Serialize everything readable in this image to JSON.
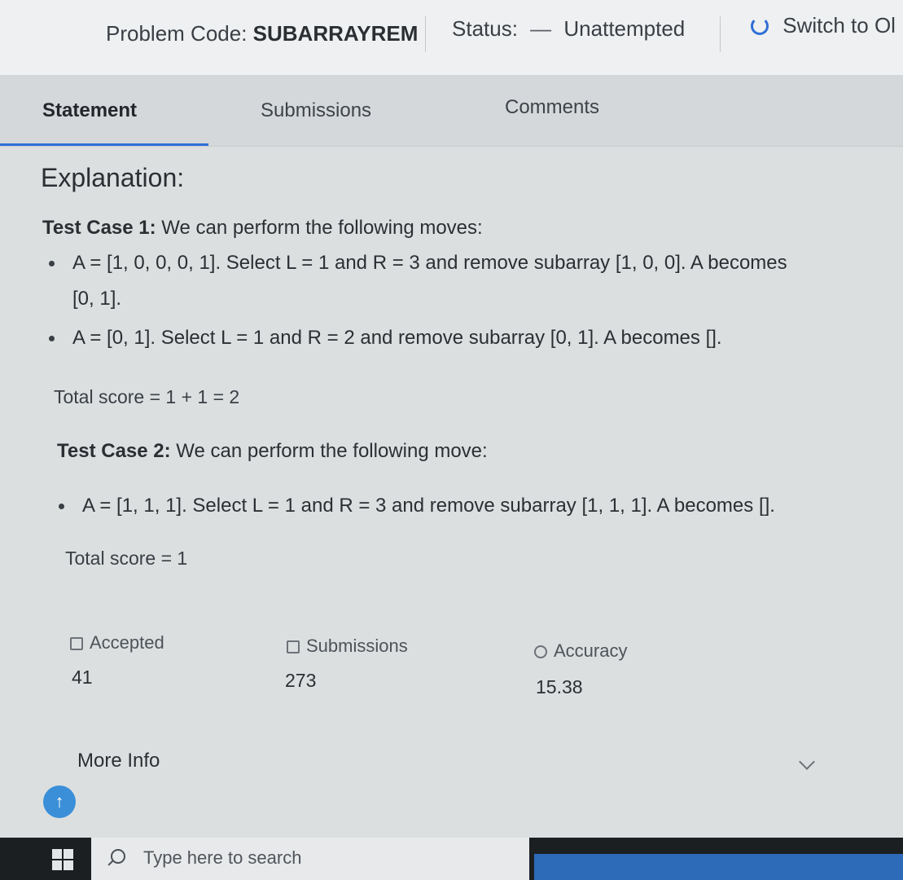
{
  "header": {
    "problem_code_label": "Problem Code:",
    "problem_code": "SUBARRAYREM",
    "status_label": "Status:",
    "status_dash": "—",
    "status_value": "Unattempted",
    "switch_label": "Switch to Ol",
    "switch_icon": "refresh-icon"
  },
  "tabs": [
    {
      "label": "Statement",
      "active": true
    },
    {
      "label": "Submissions",
      "active": false
    },
    {
      "label": "Comments",
      "active": false
    }
  ],
  "explanation": {
    "heading": "Explanation:",
    "test_case_1": {
      "title": "Test Case 1:",
      "intro": " We can perform the following moves:",
      "bullets": [
        {
          "line1": "A = [1, 0, 0, 0, 1]. Select L = 1 and R = 3 and remove subarray [1, 0, 0]. A becomes",
          "line2": "[0, 1]."
        },
        {
          "line1": "A = [0, 1]. Select L = 1 and R = 2 and remove subarray [0, 1]. A becomes []."
        }
      ],
      "score": "Total score = 1 + 1 = 2"
    },
    "test_case_2": {
      "title": "Test Case 2:",
      "intro": " We can perform the following move:",
      "bullets": [
        {
          "line1": "A = [1, 1, 1]. Select L = 1 and R = 3 and remove subarray [1, 1, 1]. A becomes []."
        }
      ],
      "score": "Total score = 1"
    }
  },
  "stats": {
    "accepted_label": "Accepted",
    "accepted_value": "41",
    "submissions_label": "Submissions",
    "submissions_value": "273",
    "accuracy_label": "Accuracy",
    "accuracy_value": "15.38"
  },
  "more_info": "More Info",
  "scroll_top_icon": "arrow-up-icon",
  "taskbar": {
    "search_placeholder": "Type here to search"
  }
}
